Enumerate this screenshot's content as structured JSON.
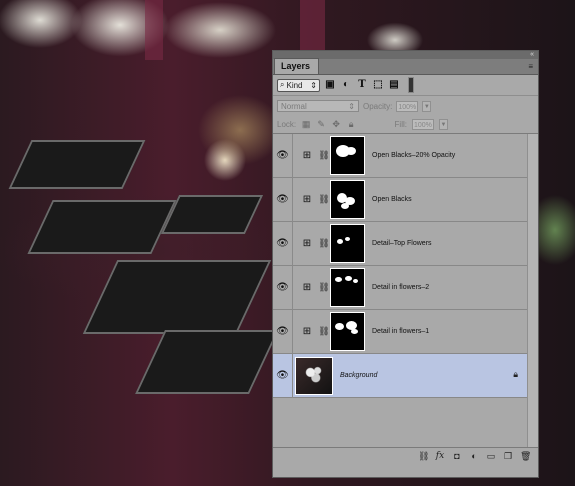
{
  "panel": {
    "tab_label": "Layers",
    "collapse_glyph": "«",
    "menu_glyph": "≡"
  },
  "filter": {
    "kind_label": "Kind",
    "icons": [
      "image-filter-icon",
      "adjustment-filter-icon",
      "type-filter-icon",
      "shape-filter-icon",
      "smart-object-filter-icon"
    ]
  },
  "blend": {
    "mode": "Normal",
    "opacity_label": "Opacity:",
    "opacity_value": "100%",
    "fill_label": "Fill:",
    "fill_value": "100%"
  },
  "lock": {
    "label": "Lock:"
  },
  "layers": [
    {
      "name": "Open Blacks–20% Opacity",
      "type": "curves",
      "visible": true
    },
    {
      "name": "Open Blacks",
      "type": "curves",
      "visible": true
    },
    {
      "name": "Detail–Top Flowers",
      "type": "curves",
      "visible": true
    },
    {
      "name": "Detail in flowers–2",
      "type": "curves",
      "visible": true
    },
    {
      "name": "Detail in flowers–1",
      "type": "curves",
      "visible": true
    },
    {
      "name": "Background",
      "type": "pixel",
      "visible": true,
      "locked": true,
      "selected": true
    }
  ],
  "bottom_icons": [
    "link-layers-icon",
    "fx-icon",
    "add-mask-icon",
    "new-adjustment-icon",
    "new-group-icon",
    "new-layer-icon",
    "delete-layer-icon"
  ],
  "colors": {
    "panel_bg": "#a9a9a9",
    "selected_layer": "#b9c5e2"
  }
}
